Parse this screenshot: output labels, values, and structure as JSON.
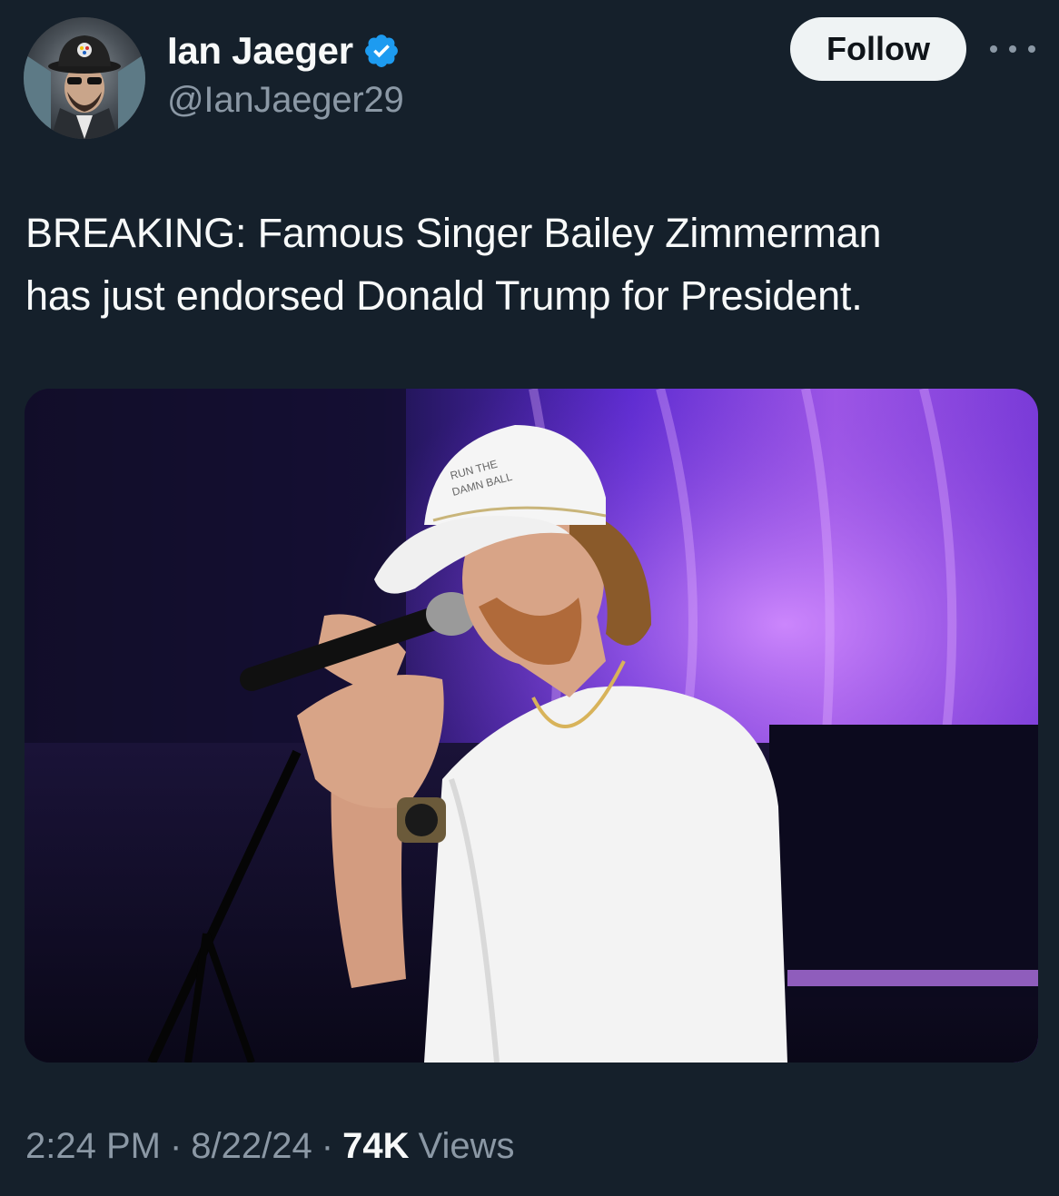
{
  "author": {
    "display_name": "Ian Jaeger",
    "handle": "@IanJaeger29",
    "verified": true,
    "verified_color": "#1d9bf0"
  },
  "actions": {
    "follow_label": "Follow",
    "more_icon": "more-horizontal-icon"
  },
  "tweet": {
    "text_line_1": "BREAKING: Famous Singer Bailey Zimmerman",
    "text_line_2": "has just endorsed Donald Trump for President."
  },
  "media": {
    "cap_text_line_1": "RUN THE",
    "cap_text_line_2": "DAMN BALL"
  },
  "meta": {
    "time": "2:24 PM",
    "separator": "·",
    "date": "8/22/24",
    "views_count": "74K",
    "views_label": "Views"
  },
  "colors": {
    "background": "#15202b",
    "primary_text": "#f7f9f9",
    "secondary_text": "#8b98a5",
    "follow_bg": "#eff3f4"
  }
}
